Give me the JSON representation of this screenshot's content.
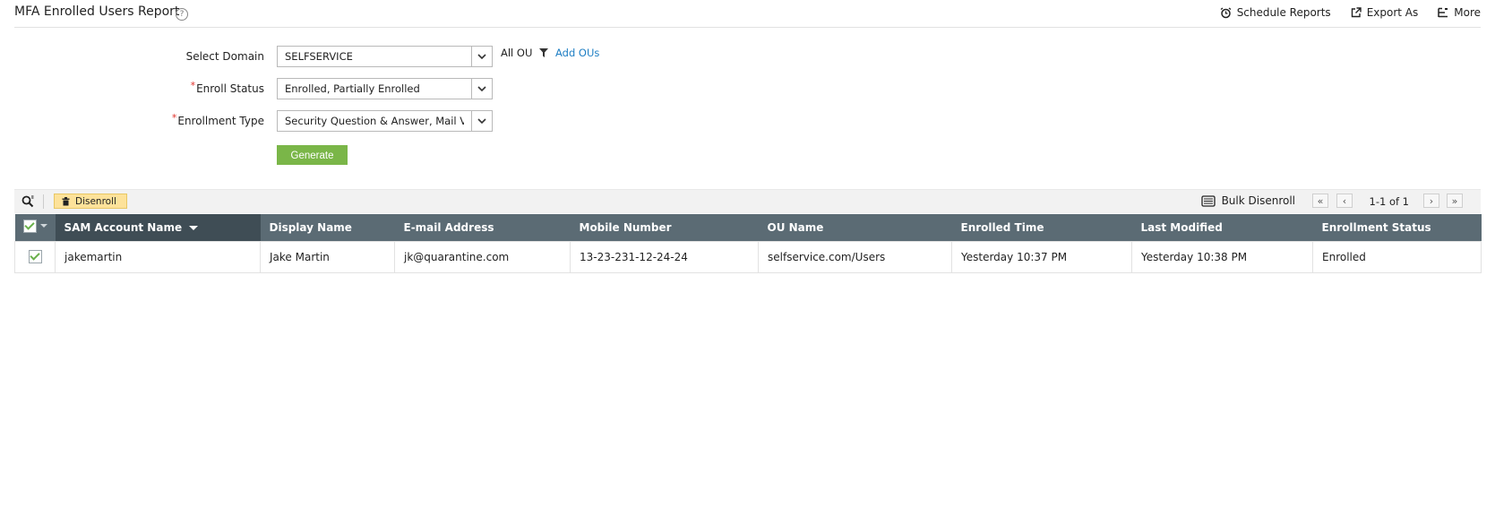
{
  "header": {
    "title": "MFA Enrolled Users Report",
    "help_icon": "question-circle-icon",
    "actions": {
      "schedule": "Schedule Reports",
      "export": "Export As",
      "more": "More"
    }
  },
  "form": {
    "domain_label": "Select Domain",
    "domain_value": "SELFSERVICE",
    "ou_scope": "All OU",
    "add_ous": "Add OUs",
    "enroll_status_label": "Enroll Status",
    "enroll_status_value": "Enrolled, Partially Enrolled",
    "enrollment_type_label": "Enrollment Type",
    "enrollment_type_value": "Security Question & Answer, Mail Ver",
    "required_marker": "*",
    "generate": "Generate"
  },
  "toolbar": {
    "disenroll": "Disenroll",
    "bulk_disenroll": "Bulk Disenroll",
    "page_info": "1-1 of 1",
    "first": "«",
    "prev": "‹",
    "next": "›",
    "last": "»"
  },
  "table": {
    "columns": [
      "SAM Account Name",
      "Display Name",
      "E-mail Address",
      "Mobile Number",
      "OU Name",
      "Enrolled Time",
      "Last Modified",
      "Enrollment Status"
    ],
    "rows": [
      [
        "jakemartin",
        "Jake Martin",
        "jk@quarantine.com",
        "13-23-231-12-24-24",
        "selfservice.com/Users",
        "Yesterday 10:37 PM",
        "Yesterday 10:38 PM",
        "Enrolled"
      ]
    ]
  },
  "colors": {
    "accent_green": "#7ab648",
    "link_blue": "#1f7fc4",
    "header_gray": "#5b6b74",
    "disenroll_yellow": "#fde29a"
  }
}
